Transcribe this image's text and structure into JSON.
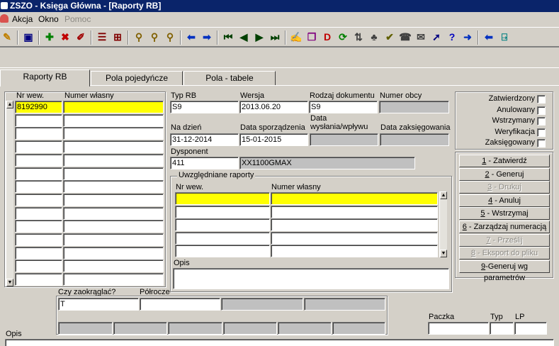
{
  "window": {
    "title": "ZSZO - Księga Główna - [Raporty RB]"
  },
  "menu": [
    {
      "label": "Akcja",
      "disabled": false
    },
    {
      "label": "Okno",
      "disabled": false
    },
    {
      "label": "Pomoc",
      "disabled": true
    }
  ],
  "toolbar": [
    {
      "name": "edit-icon",
      "glyph": "✎",
      "color": "#c08000"
    },
    {
      "name": "save-icon",
      "glyph": "▣",
      "color": "#000080"
    },
    {
      "name": "add-icon",
      "glyph": "✚",
      "color": "#008000"
    },
    {
      "name": "delete-icon",
      "glyph": "✖",
      "color": "#c00000"
    },
    {
      "name": "eraser-icon",
      "glyph": "✐",
      "color": "#a00000"
    },
    {
      "name": "insert-row-icon",
      "glyph": "☰",
      "color": "#800000"
    },
    {
      "name": "grid-icon",
      "glyph": "⊞",
      "color": "#800000"
    },
    {
      "name": "search-icon",
      "glyph": "⚲",
      "color": "#806000"
    },
    {
      "name": "search-next-icon",
      "glyph": "⚲",
      "color": "#806000"
    },
    {
      "name": "search-clear-icon",
      "glyph": "⚲",
      "color": "#806000"
    },
    {
      "name": "arrow-left-icon",
      "glyph": "⬅",
      "color": "#0030c0"
    },
    {
      "name": "arrow-right-icon",
      "glyph": "➡",
      "color": "#0030c0"
    },
    {
      "name": "first-record-icon",
      "glyph": "⏮",
      "color": "#004000"
    },
    {
      "name": "prev-record-icon",
      "glyph": "◀",
      "color": "#004000"
    },
    {
      "name": "next-record-icon",
      "glyph": "▶",
      "color": "#004000"
    },
    {
      "name": "last-record-icon",
      "glyph": "⏭",
      "color": "#004000"
    },
    {
      "name": "document-edit-icon",
      "glyph": "✍",
      "color": "#404040"
    },
    {
      "name": "documents-icon",
      "glyph": "❐",
      "color": "#800080"
    },
    {
      "name": "document-delete-icon",
      "glyph": "D",
      "color": "#c00000"
    },
    {
      "name": "refresh-icon",
      "glyph": "⟳",
      "color": "#008000"
    },
    {
      "name": "sort-icon",
      "glyph": "⇅",
      "color": "#404040"
    },
    {
      "name": "tree-icon",
      "glyph": "♣",
      "color": "#404040"
    },
    {
      "name": "check-icon",
      "glyph": "✔",
      "color": "#606000"
    },
    {
      "name": "phone-icon",
      "glyph": "☎",
      "color": "#404040"
    },
    {
      "name": "mail-icon",
      "glyph": "✉",
      "color": "#404040"
    },
    {
      "name": "pointer-icon",
      "glyph": "➚",
      "color": "#000080"
    },
    {
      "name": "help-icon",
      "glyph": "?",
      "color": "#0000c0"
    },
    {
      "name": "forward-icon",
      "glyph": "➜",
      "color": "#0030c0"
    },
    {
      "name": "back-icon",
      "glyph": "⬅",
      "color": "#0030c0"
    },
    {
      "name": "exit-icon",
      "glyph": "⍈",
      "color": "#008080"
    }
  ],
  "tabs": [
    {
      "label": "Raporty RB",
      "active": true
    },
    {
      "label": "Pola pojedyńcze",
      "active": false
    },
    {
      "label": "Pola - tabele",
      "active": false
    }
  ],
  "left_list": {
    "col1_header": "Nr wew.",
    "col2_header": "Numer własny",
    "rows": [
      {
        "nr": "8192990",
        "numer": ""
      },
      {
        "nr": "",
        "numer": ""
      },
      {
        "nr": "",
        "numer": ""
      },
      {
        "nr": "",
        "numer": ""
      },
      {
        "nr": "",
        "numer": ""
      },
      {
        "nr": "",
        "numer": ""
      },
      {
        "nr": "",
        "numer": ""
      },
      {
        "nr": "",
        "numer": ""
      },
      {
        "nr": "",
        "numer": ""
      },
      {
        "nr": "",
        "numer": ""
      },
      {
        "nr": "",
        "numer": ""
      },
      {
        "nr": "",
        "numer": ""
      },
      {
        "nr": "",
        "numer": ""
      },
      {
        "nr": "",
        "numer": ""
      }
    ]
  },
  "form": {
    "typ_rb": {
      "label": "Typ RB",
      "value": "S9"
    },
    "wersja": {
      "label": "Wersja",
      "value": "2013.06.20"
    },
    "rodzaj": {
      "label": "Rodzaj dokumentu",
      "value": "S9"
    },
    "numer_obcy": {
      "label": "Numer obcy",
      "value": ""
    },
    "na_dzien": {
      "label": "Na dzień",
      "value": "31-12-2014"
    },
    "data_sporz": {
      "label": "Data sporządzenia",
      "value": "15-01-2015"
    },
    "data_wysl": {
      "label": "Data\nwysłania/wpływu",
      "value": ""
    },
    "data_zaks": {
      "label": "Data zaksięgowania",
      "value": ""
    },
    "dysponent": {
      "label": "Dysponent",
      "code": "411",
      "name": "XX1100GMAX"
    }
  },
  "uwzgl": {
    "title": "Uwzględniane raporty",
    "col1_header": "Nr wew.",
    "col2_header": "Numer własny",
    "rows": [
      {
        "nr": "",
        "numer": ""
      },
      {
        "nr": "",
        "numer": ""
      },
      {
        "nr": "",
        "numer": ""
      },
      {
        "nr": "",
        "numer": ""
      },
      {
        "nr": "",
        "numer": ""
      }
    ],
    "opis_label": "Opis",
    "opis_value": ""
  },
  "status": [
    {
      "label": "Zatwierdzony"
    },
    {
      "label": "Anulowany"
    },
    {
      "label": "Wstrzymany"
    },
    {
      "label": "Weryfikacja"
    },
    {
      "label": "Zaksięgowany"
    }
  ],
  "actions": [
    {
      "key": "1",
      "label": " - Zatwierdź",
      "disabled": false
    },
    {
      "key": "2",
      "label": " - Generuj",
      "disabled": false
    },
    {
      "key": "3",
      "label": " - Drukuj",
      "disabled": true
    },
    {
      "key": "4",
      "label": " - Anuluj",
      "disabled": false
    },
    {
      "key": "5",
      "label": " - Wstrzymaj",
      "disabled": false
    },
    {
      "key": "6",
      "label": " - Zarządzaj numeracją",
      "disabled": false
    },
    {
      "key": "7",
      "label": " - Prześlij",
      "disabled": true
    },
    {
      "key": "8",
      "label": " - Eksport do pliku",
      "disabled": true
    },
    {
      "key": "9",
      "label": "-Generuj wg parametrów",
      "disabled": false
    }
  ],
  "bottom": {
    "czy_label": "Czy zaokrąglać?",
    "czy_value": "T",
    "polrocze_label": "Półrocze",
    "polrocze_value": "",
    "paczka_label": "Paczka",
    "typ_label": "Typ",
    "lp_label": "LP",
    "opis_label": "Opis"
  }
}
